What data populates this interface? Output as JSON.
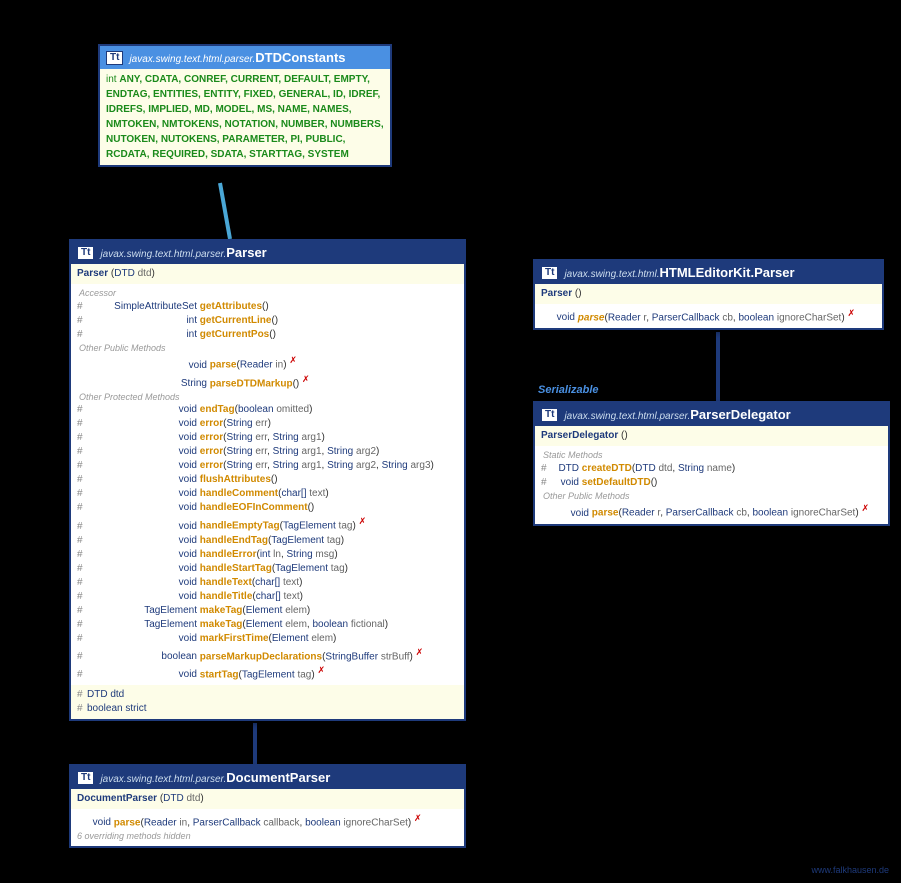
{
  "dtdc": {
    "pkg": "javax.swing.text.html.parser.",
    "name": "DTDConstants",
    "int": "int",
    "constants": "ANY, CDATA, CONREF, CURRENT, DEFAULT, EMPTY, ENDTAG, ENTITIES, ENTITY, FIXED, GENERAL, ID, IDREF, IDREFS, IMPLIED, MD, MODEL, MS, NAME, NAMES, NMTOKEN, NMTOKENS, NOTATION, NUMBER, NUMBERS, NUTOKEN, NUTOKENS, PARAMETER, PI, PUBLIC, RCDATA, REQUIRED, SDATA, STARTTAG, SYSTEM"
  },
  "parser": {
    "pkg": "javax.swing.text.html.parser.",
    "name": "Parser",
    "ctor": {
      "name": "Parser",
      "ptype": "DTD",
      "pname": "dtd"
    },
    "sec_accessor": "Accessor",
    "acc": [
      {
        "ret": "SimpleAttributeSet",
        "name": "getAttributes"
      },
      {
        "ret": "int",
        "name": "getCurrentLine"
      },
      {
        "ret": "int",
        "name": "getCurrentPos"
      }
    ],
    "sec_other_pub": "Other Public Methods",
    "pub": [
      {
        "ret": "void",
        "name": "parse",
        "params": [
          {
            "t": "Reader",
            "n": "in"
          }
        ],
        "throws": true
      },
      {
        "ret": "String",
        "name": "parseDTDMarkup",
        "params": [],
        "throws": true
      }
    ],
    "sec_other_prot": "Other Protected Methods",
    "prot": [
      {
        "ret": "void",
        "name": "endTag",
        "params": [
          {
            "t": "boolean",
            "n": "omitted"
          }
        ]
      },
      {
        "ret": "void",
        "name": "error",
        "params": [
          {
            "t": "String",
            "n": "err"
          }
        ]
      },
      {
        "ret": "void",
        "name": "error",
        "params": [
          {
            "t": "String",
            "n": "err"
          },
          {
            "t": "String",
            "n": "arg1"
          }
        ]
      },
      {
        "ret": "void",
        "name": "error",
        "params": [
          {
            "t": "String",
            "n": "err"
          },
          {
            "t": "String",
            "n": "arg1"
          },
          {
            "t": "String",
            "n": "arg2"
          }
        ]
      },
      {
        "ret": "void",
        "name": "error",
        "params": [
          {
            "t": "String",
            "n": "err"
          },
          {
            "t": "String",
            "n": "arg1"
          },
          {
            "t": "String",
            "n": "arg2"
          },
          {
            "t": "String",
            "n": "arg3"
          }
        ]
      },
      {
        "ret": "void",
        "name": "flushAttributes",
        "params": []
      },
      {
        "ret": "void",
        "name": "handleComment",
        "params": [
          {
            "t": "char[]",
            "n": "text"
          }
        ]
      },
      {
        "ret": "void",
        "name": "handleEOFInComment",
        "params": []
      },
      {
        "ret": "void",
        "name": "handleEmptyTag",
        "params": [
          {
            "t": "TagElement",
            "n": "tag"
          }
        ],
        "throws": true
      },
      {
        "ret": "void",
        "name": "handleEndTag",
        "params": [
          {
            "t": "TagElement",
            "n": "tag"
          }
        ]
      },
      {
        "ret": "void",
        "name": "handleError",
        "params": [
          {
            "t": "int",
            "n": "ln"
          },
          {
            "t": "String",
            "n": "msg"
          }
        ]
      },
      {
        "ret": "void",
        "name": "handleStartTag",
        "params": [
          {
            "t": "TagElement",
            "n": "tag"
          }
        ]
      },
      {
        "ret": "void",
        "name": "handleText",
        "params": [
          {
            "t": "char[]",
            "n": "text"
          }
        ]
      },
      {
        "ret": "void",
        "name": "handleTitle",
        "params": [
          {
            "t": "char[]",
            "n": "text"
          }
        ]
      },
      {
        "ret": "TagElement",
        "name": "makeTag",
        "params": [
          {
            "t": "Element",
            "n": "elem"
          }
        ]
      },
      {
        "ret": "TagElement",
        "name": "makeTag",
        "params": [
          {
            "t": "Element",
            "n": "elem"
          },
          {
            "t": "boolean",
            "n": "fictional"
          }
        ]
      },
      {
        "ret": "void",
        "name": "markFirstTime",
        "params": [
          {
            "t": "Element",
            "n": "elem"
          }
        ]
      },
      {
        "ret": "boolean",
        "name": "parseMarkupDeclarations",
        "params": [
          {
            "t": "StringBuffer",
            "n": "strBuff"
          }
        ],
        "throws": true
      },
      {
        "ret": "void",
        "name": "startTag",
        "params": [
          {
            "t": "TagElement",
            "n": "tag"
          }
        ],
        "throws": true
      }
    ],
    "fields": [
      {
        "t": "DTD",
        "n": "dtd"
      },
      {
        "t": "boolean",
        "n": "strict"
      }
    ]
  },
  "docparser": {
    "pkg": "javax.swing.text.html.parser.",
    "name": "DocumentParser",
    "ctor": {
      "name": "DocumentParser",
      "ptype": "DTD",
      "pname": "dtd"
    },
    "method": {
      "ret": "void",
      "name": "parse",
      "params": [
        {
          "t": "Reader",
          "n": "in"
        },
        {
          "t": "ParserCallback",
          "n": "callback"
        },
        {
          "t": "boolean",
          "n": "ignoreCharSet"
        }
      ],
      "throws": true
    },
    "hidden": "6 overriding methods hidden"
  },
  "htmlparser": {
    "pkg": "javax.swing.text.html.",
    "name": "HTMLEditorKit.Parser",
    "ctor": {
      "name": "Parser"
    },
    "method": {
      "ret": "void",
      "name": "parse",
      "params": [
        {
          "t": "Reader",
          "n": "r"
        },
        {
          "t": "ParserCallback",
          "n": "cb"
        },
        {
          "t": "boolean",
          "n": "ignoreCharSet"
        }
      ],
      "throws": true,
      "italic": true
    }
  },
  "serializable": "Serializable",
  "delegator": {
    "pkg": "javax.swing.text.html.parser.",
    "name": "ParserDelegator",
    "ctor": {
      "name": "ParserDelegator"
    },
    "sec_static": "Static Methods",
    "static": [
      {
        "ret": "DTD",
        "name": "createDTD",
        "params": [
          {
            "t": "DTD",
            "n": "dtd"
          },
          {
            "t": "String",
            "n": "name"
          }
        ]
      },
      {
        "ret": "void",
        "name": "setDefaultDTD",
        "params": []
      }
    ],
    "sec_other_pub": "Other Public Methods",
    "pub": {
      "ret": "void",
      "name": "parse",
      "params": [
        {
          "t": "Reader",
          "n": "r"
        },
        {
          "t": "ParserCallback",
          "n": "cb"
        },
        {
          "t": "boolean",
          "n": "ignoreCharSet"
        }
      ],
      "throws": true
    }
  },
  "footer": "www.falkhausen.de"
}
